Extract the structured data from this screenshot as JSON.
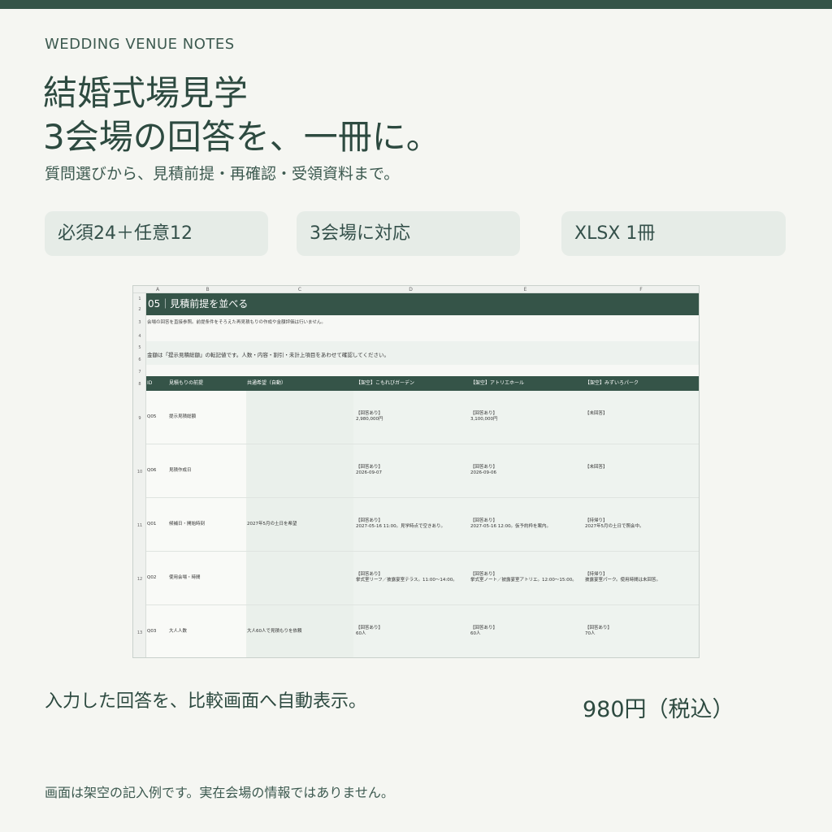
{
  "brand": {
    "eyebrow": "WEDDING VENUE NOTES"
  },
  "headline": {
    "line1": "結婚式場見学",
    "line2": "3会場の回答を、一冊に。"
  },
  "subhead": "質問選びから、見積前提・再確認・受領資料まで。",
  "features": [
    "必須24＋任意12",
    "3会場に対応",
    "XLSX 1冊"
  ],
  "sheet": {
    "columns": [
      "A",
      "B",
      "C",
      "D",
      "E",
      "F"
    ],
    "title": "05｜見積前提を並べる",
    "note1": "会場の回答を直接参照。前提条件をそろえた再見積もりの作成や金額評価は行いません。",
    "note2": "金額は「提示見積総額」の転記値です。人数・内容・割引・未計上項目をあわせて確認してください。",
    "headers": [
      "ID",
      "見積もりの前提",
      "共通希望（自動）",
      "【架空】こもれびガーデン",
      "【架空】アトリエホール",
      "【架空】みずいろパーク"
    ],
    "rows": [
      {
        "num": "9",
        "id": "Q05",
        "q": "提示見積総額",
        "common": "",
        "v1a": "【回答あり】",
        "v1b": "2,980,000円",
        "v2a": "【回答あり】",
        "v2b": "3,100,000円",
        "v3a": "【未回答】",
        "v3b": ""
      },
      {
        "num": "10",
        "id": "Q06",
        "q": "見積作成日",
        "common": "",
        "v1a": "【回答あり】",
        "v1b": "2026-09-07",
        "v2a": "【回答あり】",
        "v2b": "2026-09-06",
        "v3a": "【未回答】",
        "v3b": ""
      },
      {
        "num": "11",
        "id": "Q01",
        "q": "候補日・開始時刻",
        "common": "2027年5月の土日を希望",
        "v1a": "【回答あり】",
        "v1b": "2027-05-16 11:00。見学時点で空きあり。",
        "v2a": "【回答あり】",
        "v2b": "2027-05-16 12:00。仮予約枠を案内。",
        "v3a": "【持帰り】",
        "v3b": "2027年5月の土日で照会中。"
      },
      {
        "num": "12",
        "id": "Q02",
        "q": "使用会場・時間",
        "common": "",
        "v1a": "【回答あり】",
        "v1b": "挙式室リーフ／披露宴室テラス。11:00〜14:00。",
        "v2a": "【回答あり】",
        "v2b": "挙式室ノート／披露宴室アトリエ。12:00〜15:00。",
        "v3a": "【持帰り】",
        "v3b": "披露宴室パーク。使用時間は未回答。"
      },
      {
        "num": "13",
        "id": "Q03",
        "q": "大人人数",
        "common": "大人60人で見積もりを依頼",
        "v1a": "【回答あり】",
        "v1b": "60人",
        "v2a": "【回答あり】",
        "v2b": "60人",
        "v3a": "【回答あり】",
        "v3b": "70人"
      }
    ],
    "rownums": [
      "1",
      "2",
      "3",
      "4",
      "5",
      "6",
      "7",
      "8"
    ]
  },
  "caption": "入力した回答を、比較画面へ自動表示。",
  "price": "980円（税込）",
  "footnote": "画面は架空の記入例です。実在会場の情報ではありません。"
}
